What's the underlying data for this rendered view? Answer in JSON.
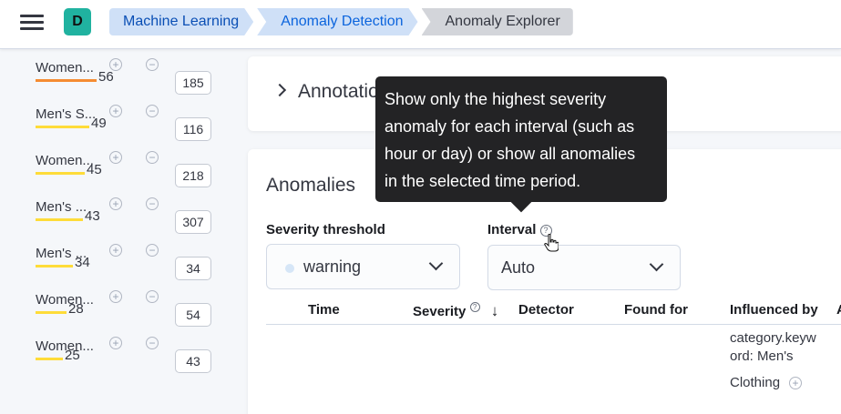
{
  "header": {
    "avatar_letter": "D",
    "breadcrumbs": [
      "Machine Learning",
      "Anomaly Detection",
      "Anomaly Explorer"
    ]
  },
  "influencers": [
    {
      "name": "Women...",
      "score": "56",
      "count": "185",
      "bar": "orange",
      "bar_fraction": 0.56
    },
    {
      "name": "Men's S...",
      "score": "49",
      "count": "116",
      "bar": "yellow",
      "bar_fraction": 0.49
    },
    {
      "name": "Women...",
      "score": "45",
      "count": "218",
      "bar": "yellow",
      "bar_fraction": 0.45
    },
    {
      "name": "Men's ...",
      "score": "43",
      "count": "307",
      "bar": "yellow",
      "bar_fraction": 0.43
    },
    {
      "name": "Men's ...",
      "score": "34",
      "count": "34",
      "bar": "yellow",
      "bar_fraction": 0.34
    },
    {
      "name": "Women...",
      "score": "28",
      "count": "54",
      "bar": "yellow",
      "bar_fraction": 0.28
    },
    {
      "name": "Women...",
      "score": "25",
      "count": "43",
      "bar": "yellow",
      "bar_fraction": 0.25
    }
  ],
  "annotations": {
    "title": "Annotatio"
  },
  "anomalies": {
    "title": "Anomalies",
    "severity_label": "Severity threshold",
    "severity_value": "warning",
    "interval_label": "Interval",
    "interval_value": "Auto",
    "columns": [
      "Time",
      "Severity",
      "Detector",
      "Found for",
      "Influenced by",
      "A"
    ],
    "row": {
      "influenced_line1": "category.keyw",
      "influenced_line2": "ord: Men's",
      "influenced_line3": "Clothing"
    }
  },
  "tooltip": {
    "line1": "Show only the highest severity",
    "line2": "anomaly for each interval (such as",
    "line3": "hour or day) or show all anomalies",
    "line4": "in the selected time period."
  },
  "colors": {
    "accent": "#0b64dd",
    "warning_bar": "#fedc39",
    "minor_bar": "#f58c32",
    "tooltip_bg": "#232325"
  },
  "icons": {
    "menu": "hamburger-icon",
    "help": "question-circle-icon",
    "plus": "plus-circle-icon",
    "minus": "minus-circle-icon",
    "sort": "arrow-down-icon"
  }
}
